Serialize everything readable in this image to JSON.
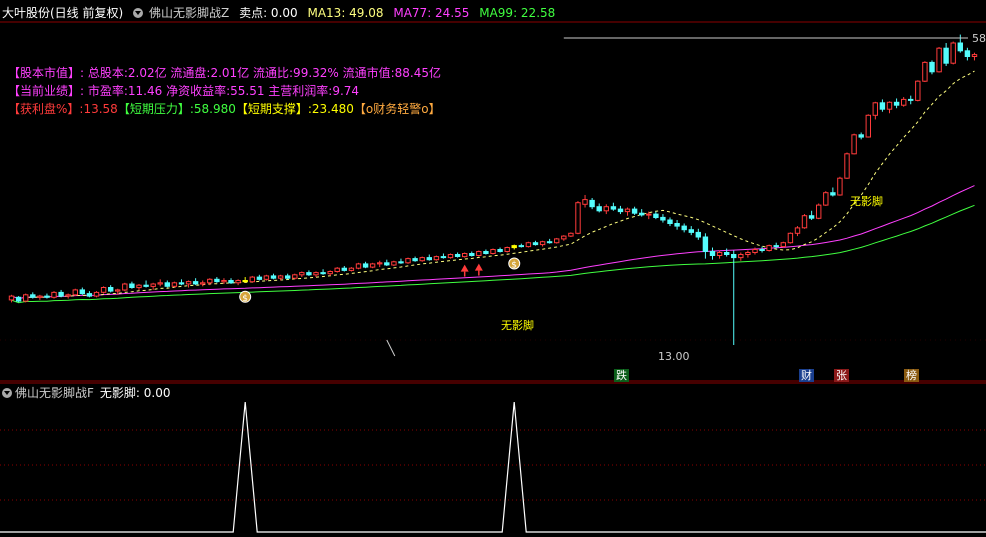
{
  "header": {
    "stock": "大叶股份(日线 前复权)",
    "indicator": "佛山无影脚战Z",
    "sell": "卖点: 0.00",
    "ma13": "MA13: 49.08",
    "ma77": "MA77: 24.55",
    "ma99": "MA99: 22.58"
  },
  "info": {
    "line1": "【股本市值】: 总股本:2.02亿 流通盘:2.01亿 流通比:99.32% 流通市值:88.45亿",
    "line2": "【当前业绩】: 市盈率:11.46 净资收益率:55.51 主营利润率:9.74",
    "line3a": "【获利盘%】:13.58",
    "line3b": "【短期压力】:58.980",
    "line3c": "【短期支撑】:23.480",
    "line3d": "【o财务轻警o】"
  },
  "labels": {
    "wuyingjiao": "无影脚",
    "high": "58",
    "low": "13.00",
    "tag_die": "跌",
    "tag_cai": "财",
    "tag_zhang": "张",
    "tag_bang": "榜"
  },
  "sub_panel": {
    "title": "佛山无影脚战F",
    "value": "无影脚: 0.00"
  },
  "colors": {
    "up": "#ff3b3b",
    "down": "#54fcfc",
    "signal": "#ffff00",
    "ma13": "#ffff80",
    "ma77": "#ff40ff",
    "ma99": "#40ff40",
    "grid": "#8b0000"
  },
  "chart_data": {
    "type": "candlestick",
    "price_range": [
      13,
      58
    ],
    "price_high_mark": 58,
    "price_low_mark": 13.0,
    "candles": [
      [
        16.2,
        16.6,
        16.0,
        16.5
      ],
      [
        16.4,
        16.5,
        16.0,
        16.1
      ],
      [
        16.1,
        16.7,
        16.0,
        16.6
      ],
      [
        16.6,
        16.8,
        16.3,
        16.4
      ],
      [
        16.4,
        16.6,
        16.2,
        16.5
      ],
      [
        16.5,
        16.7,
        16.3,
        16.4
      ],
      [
        16.4,
        16.9,
        16.3,
        16.8
      ],
      [
        16.8,
        17.0,
        16.4,
        16.5
      ],
      [
        16.5,
        16.7,
        16.3,
        16.6
      ],
      [
        16.6,
        17.1,
        16.5,
        17.0
      ],
      [
        17.0,
        17.2,
        16.6,
        16.7
      ],
      [
        16.7,
        16.9,
        16.4,
        16.5
      ],
      [
        16.5,
        16.9,
        16.4,
        16.8
      ],
      [
        16.8,
        17.3,
        16.7,
        17.2
      ],
      [
        17.2,
        17.4,
        16.8,
        16.9
      ],
      [
        16.9,
        17.1,
        16.6,
        17.0
      ],
      [
        17.0,
        17.6,
        16.9,
        17.5
      ],
      [
        17.5,
        17.7,
        17.1,
        17.2
      ],
      [
        17.2,
        17.5,
        17.0,
        17.4
      ],
      [
        17.4,
        17.8,
        17.2,
        17.3
      ],
      [
        17.3,
        17.6,
        17.0,
        17.5
      ],
      [
        17.5,
        17.9,
        17.3,
        17.6
      ],
      [
        17.6,
        17.8,
        17.2,
        17.3
      ],
      [
        17.3,
        17.7,
        17.2,
        17.6
      ],
      [
        17.6,
        17.9,
        17.4,
        17.5
      ],
      [
        17.5,
        17.8,
        17.2,
        17.7
      ],
      [
        17.7,
        18.0,
        17.4,
        17.5
      ],
      [
        17.5,
        17.8,
        17.3,
        17.6
      ],
      [
        17.6,
        18.0,
        17.4,
        17.9
      ],
      [
        17.9,
        18.1,
        17.6,
        17.7
      ],
      [
        17.7,
        18.0,
        17.5,
        17.8
      ],
      [
        17.8,
        18.0,
        17.5,
        17.6
      ],
      [
        17.6,
        17.9,
        17.4,
        17.8
      ],
      [
        17.8,
        18.1,
        17.6,
        17.7
      ],
      [
        17.7,
        18.2,
        17.6,
        18.1
      ],
      [
        18.1,
        18.3,
        17.8,
        17.9
      ],
      [
        17.9,
        18.3,
        17.8,
        18.2
      ],
      [
        18.2,
        18.4,
        17.9,
        18.0
      ],
      [
        18.0,
        18.3,
        17.8,
        18.2
      ],
      [
        18.2,
        18.4,
        17.9,
        18.0
      ],
      [
        18.0,
        18.4,
        17.9,
        18.3
      ],
      [
        18.3,
        18.6,
        18.1,
        18.5
      ],
      [
        18.5,
        18.7,
        18.2,
        18.3
      ],
      [
        18.3,
        18.6,
        18.1,
        18.5
      ],
      [
        18.5,
        18.8,
        18.3,
        18.4
      ],
      [
        18.4,
        18.7,
        18.2,
        18.6
      ],
      [
        18.6,
        19.0,
        18.5,
        18.9
      ],
      [
        18.9,
        19.1,
        18.6,
        18.7
      ],
      [
        18.7,
        19.0,
        18.6,
        18.9
      ],
      [
        18.9,
        19.4,
        18.8,
        19.3
      ],
      [
        19.3,
        19.5,
        18.9,
        19.0
      ],
      [
        19.0,
        19.4,
        18.9,
        19.3
      ],
      [
        19.3,
        19.6,
        19.0,
        19.4
      ],
      [
        19.4,
        19.7,
        19.1,
        19.2
      ],
      [
        19.2,
        19.6,
        19.1,
        19.5
      ],
      [
        19.5,
        19.8,
        19.3,
        19.4
      ],
      [
        19.4,
        19.9,
        19.3,
        19.8
      ],
      [
        19.8,
        20.0,
        19.5,
        19.6
      ],
      [
        19.6,
        20.0,
        19.5,
        19.9
      ],
      [
        19.9,
        20.2,
        19.6,
        19.7
      ],
      [
        19.7,
        20.1,
        19.6,
        20.0
      ],
      [
        20.0,
        20.3,
        19.8,
        19.9
      ],
      [
        19.9,
        20.3,
        19.8,
        20.2
      ],
      [
        20.2,
        20.4,
        19.9,
        20.0
      ],
      [
        20.0,
        20.4,
        19.9,
        20.3
      ],
      [
        20.3,
        20.5,
        20.0,
        20.1
      ],
      [
        20.1,
        20.6,
        20.0,
        20.5
      ],
      [
        20.5,
        20.7,
        20.2,
        20.3
      ],
      [
        20.3,
        20.8,
        20.2,
        20.7
      ],
      [
        20.7,
        20.9,
        20.4,
        20.5
      ],
      [
        20.5,
        21.0,
        20.4,
        20.9
      ],
      [
        20.9,
        21.2,
        20.7,
        21.1
      ],
      [
        21.1,
        21.3,
        20.9,
        21.0
      ],
      [
        21.0,
        21.5,
        20.9,
        21.4
      ],
      [
        21.4,
        21.6,
        21.1,
        21.2
      ],
      [
        21.2,
        21.6,
        21.0,
        21.5
      ],
      [
        21.5,
        21.8,
        21.3,
        21.4
      ],
      [
        21.4,
        21.9,
        21.3,
        21.8
      ],
      [
        21.8,
        22.2,
        21.6,
        22.1
      ],
      [
        22.1,
        22.5,
        22.0,
        22.4
      ],
      [
        22.4,
        26.2,
        22.3,
        26.0
      ],
      [
        25.8,
        27.0,
        25.4,
        26.4
      ],
      [
        26.3,
        26.6,
        25.2,
        25.5
      ],
      [
        25.5,
        25.9,
        24.8,
        25.0
      ],
      [
        25.0,
        25.8,
        24.6,
        25.5
      ],
      [
        25.5,
        26.0,
        25.0,
        25.2
      ],
      [
        25.2,
        25.6,
        24.6,
        24.9
      ],
      [
        24.9,
        25.4,
        24.4,
        25.2
      ],
      [
        25.2,
        25.5,
        24.5,
        24.7
      ],
      [
        24.7,
        25.2,
        24.3,
        24.5
      ],
      [
        24.5,
        24.9,
        24.0,
        24.6
      ],
      [
        24.6,
        24.9,
        24.0,
        24.2
      ],
      [
        24.2,
        24.6,
        23.6,
        23.9
      ],
      [
        23.9,
        24.2,
        23.2,
        23.5
      ],
      [
        23.5,
        23.9,
        22.8,
        23.2
      ],
      [
        23.2,
        23.5,
        22.5,
        22.8
      ],
      [
        22.8,
        23.2,
        22.2,
        22.5
      ],
      [
        22.5,
        22.9,
        21.7,
        22.0
      ],
      [
        22.0,
        22.4,
        19.8,
        20.5
      ],
      [
        20.5,
        20.9,
        19.7,
        20.1
      ],
      [
        20.1,
        20.6,
        19.8,
        20.4
      ],
      [
        20.4,
        20.8,
        20.0,
        20.2
      ],
      [
        20.2,
        20.6,
        13.0,
        19.9
      ],
      [
        19.9,
        20.4,
        19.6,
        20.2
      ],
      [
        20.2,
        20.6,
        19.9,
        20.4
      ],
      [
        20.4,
        20.9,
        20.2,
        20.7
      ],
      [
        20.7,
        21.0,
        20.4,
        20.6
      ],
      [
        20.6,
        21.2,
        20.5,
        21.1
      ],
      [
        21.1,
        21.4,
        20.8,
        21.0
      ],
      [
        21.0,
        21.5,
        20.9,
        21.4
      ],
      [
        21.4,
        22.5,
        21.3,
        22.4
      ],
      [
        22.4,
        23.2,
        22.1,
        23.0
      ],
      [
        23.0,
        24.6,
        22.9,
        24.4
      ],
      [
        24.4,
        25.0,
        23.9,
        24.1
      ],
      [
        24.1,
        25.9,
        24.0,
        25.7
      ],
      [
        25.7,
        27.5,
        25.6,
        27.3
      ],
      [
        27.3,
        28.0,
        26.8,
        27.0
      ],
      [
        27.0,
        29.5,
        26.9,
        29.3
      ],
      [
        29.3,
        33.2,
        29.2,
        33.0
      ],
      [
        33.0,
        36.4,
        32.9,
        36.2
      ],
      [
        36.2,
        36.6,
        35.4,
        35.8
      ],
      [
        35.8,
        40.0,
        35.7,
        39.8
      ],
      [
        39.8,
        42.5,
        39.0,
        42.3
      ],
      [
        42.3,
        43.0,
        40.5,
        41.0
      ],
      [
        41.0,
        42.6,
        40.2,
        42.4
      ],
      [
        42.4,
        43.2,
        41.2,
        41.8
      ],
      [
        41.8,
        43.5,
        41.5,
        43.0
      ],
      [
        43.0,
        43.8,
        42.0,
        42.8
      ],
      [
        42.8,
        47.2,
        42.6,
        47.0
      ],
      [
        47.0,
        51.8,
        46.8,
        51.5
      ],
      [
        51.5,
        52.0,
        48.6,
        49.2
      ],
      [
        49.2,
        55.5,
        49.0,
        55.2
      ],
      [
        55.2,
        56.6,
        50.6,
        51.3
      ],
      [
        51.3,
        57.0,
        51.0,
        56.6
      ],
      [
        56.6,
        58.98,
        54.0,
        54.5
      ],
      [
        54.5,
        55.3,
        52.0,
        53.0
      ],
      [
        53.0,
        54.0,
        52.0,
        53.5
      ]
    ],
    "signals": [
      33,
      71
    ],
    "sub_series": {
      "name": "无影脚",
      "peaks_at": [
        33,
        71
      ],
      "value": 0
    }
  }
}
